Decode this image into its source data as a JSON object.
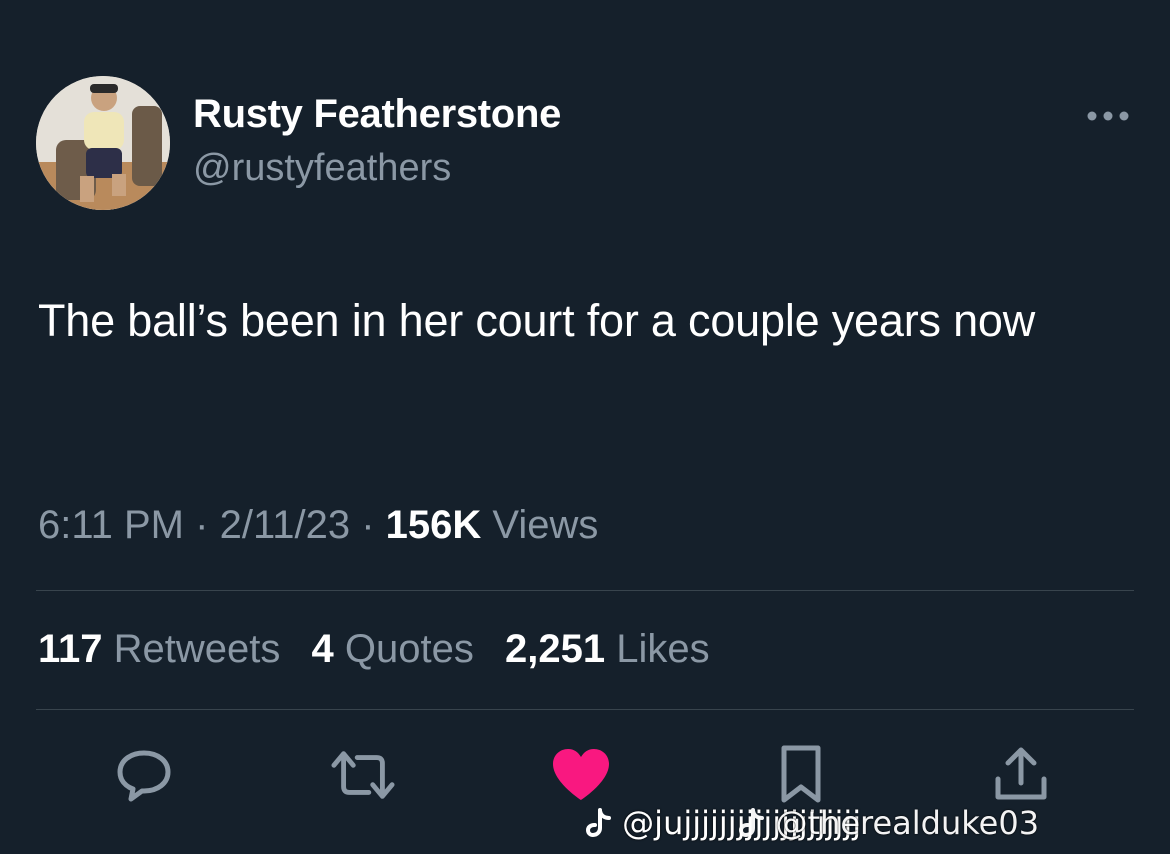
{
  "author": {
    "name": "Rusty Featherstone",
    "handle": "@rustyfeathers"
  },
  "tweet": {
    "text": "The ball’s been in her court for a couple years now"
  },
  "meta": {
    "time": "6:11 PM",
    "separator": "·",
    "date": "2/11/23",
    "views_count": "156K",
    "views_label": "Views"
  },
  "stats": {
    "retweets_count": "117",
    "retweets_label": "Retweets",
    "quotes_count": "4",
    "quotes_label": "Quotes",
    "likes_count": "2,251",
    "likes_label": "Likes"
  },
  "actions": {
    "reply_icon": "speech-bubble-icon",
    "retweet_icon": "retweet-arrows-icon",
    "like_icon": "heart-icon",
    "like_color": "#f91880",
    "bookmark_icon": "bookmark-icon",
    "share_icon": "share-upload-icon"
  },
  "watermark": {
    "primary": "@jujjjjjjjjjjjjjjjjjjjj",
    "secondary": "@therealduke03"
  },
  "colors": {
    "background": "#15202b",
    "secondary_text": "#8b98a5",
    "divider": "#38444d"
  }
}
